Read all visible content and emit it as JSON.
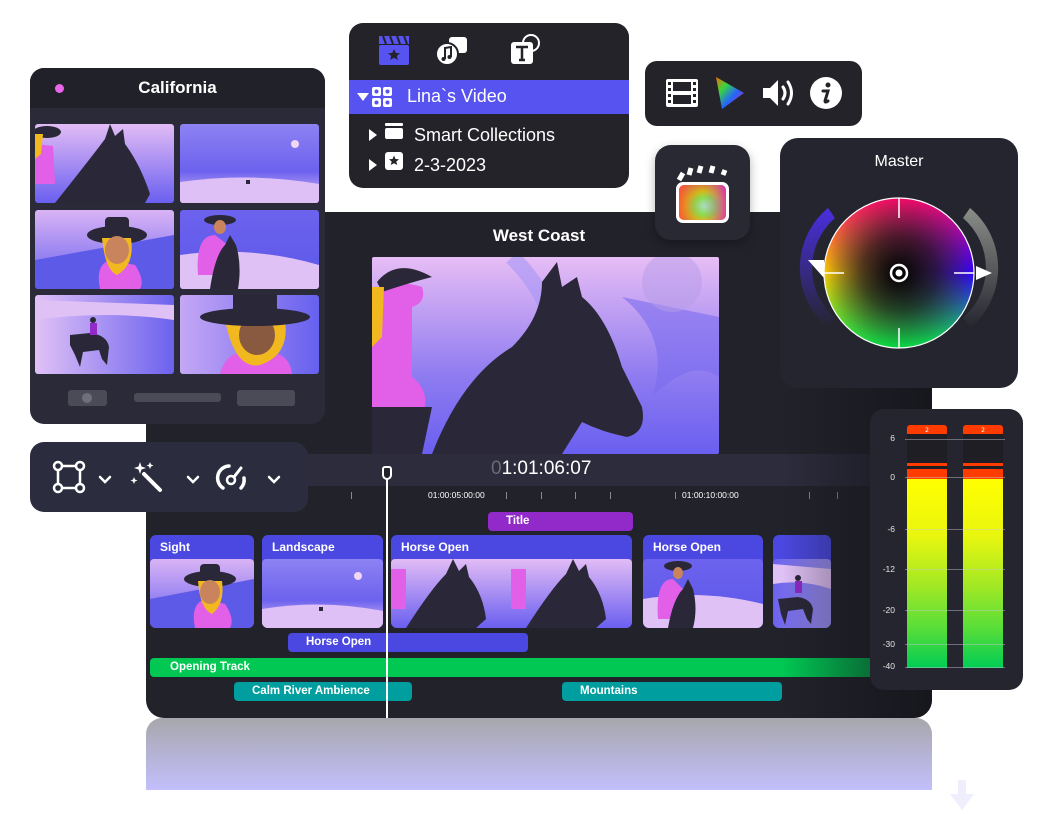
{
  "main_window": {
    "title": "West Coast",
    "timecode_dim": "0",
    "timecode": "1:01:06:07",
    "ruler_labels": [
      "01:00:05:00:00",
      "01:00:10:00:00"
    ]
  },
  "timeline": {
    "title_clip": "Title",
    "clips": [
      {
        "label": "Sight"
      },
      {
        "label": "Landscape"
      },
      {
        "label": "Horse Open"
      },
      {
        "label": "Horse Open"
      },
      {
        "label": ""
      }
    ],
    "connected_clip": "Horse Open",
    "audio_tracks": [
      {
        "label": "Opening Track",
        "color": "#00c853"
      },
      {
        "label": "Calm River Ambience",
        "color": "#009e9e"
      },
      {
        "label": "Mountains",
        "color": "#009e9e"
      }
    ],
    "title_color": "#9229c9",
    "clip_color": "#4a48e0"
  },
  "california": {
    "title": "California",
    "dot_color": "#e966e8"
  },
  "library": {
    "tabs": [
      "clapper-star-icon",
      "photos-music-icon",
      "titles-icon"
    ],
    "items": [
      {
        "label": "Lina`s Video",
        "selected": true,
        "expanded": true,
        "icon": "event-grid-icon"
      },
      {
        "label": "Smart Collections",
        "selected": false,
        "expanded": false,
        "icon": "folder-icon"
      },
      {
        "label": "2-3-2023",
        "selected": false,
        "expanded": false,
        "icon": "star-event-icon"
      }
    ],
    "accent": "#5653f0"
  },
  "inspector_bar": {
    "icons": [
      "film-icon",
      "color-icon",
      "audio-icon",
      "info-icon"
    ]
  },
  "color_panel": {
    "title": "Master"
  },
  "audio_meters": {
    "scale": [
      "6",
      "0",
      "-6",
      "-12",
      "-20",
      "-30",
      "-40"
    ],
    "peak_labels": [
      "2",
      "2"
    ],
    "channels": [
      {
        "level_db": 0,
        "peak_db": 2
      },
      {
        "level_db": 0,
        "peak_db": 2
      }
    ]
  },
  "tool_bar": {
    "tools": [
      "transform-icon",
      "enhance-wand-icon",
      "speed-icon"
    ]
  }
}
